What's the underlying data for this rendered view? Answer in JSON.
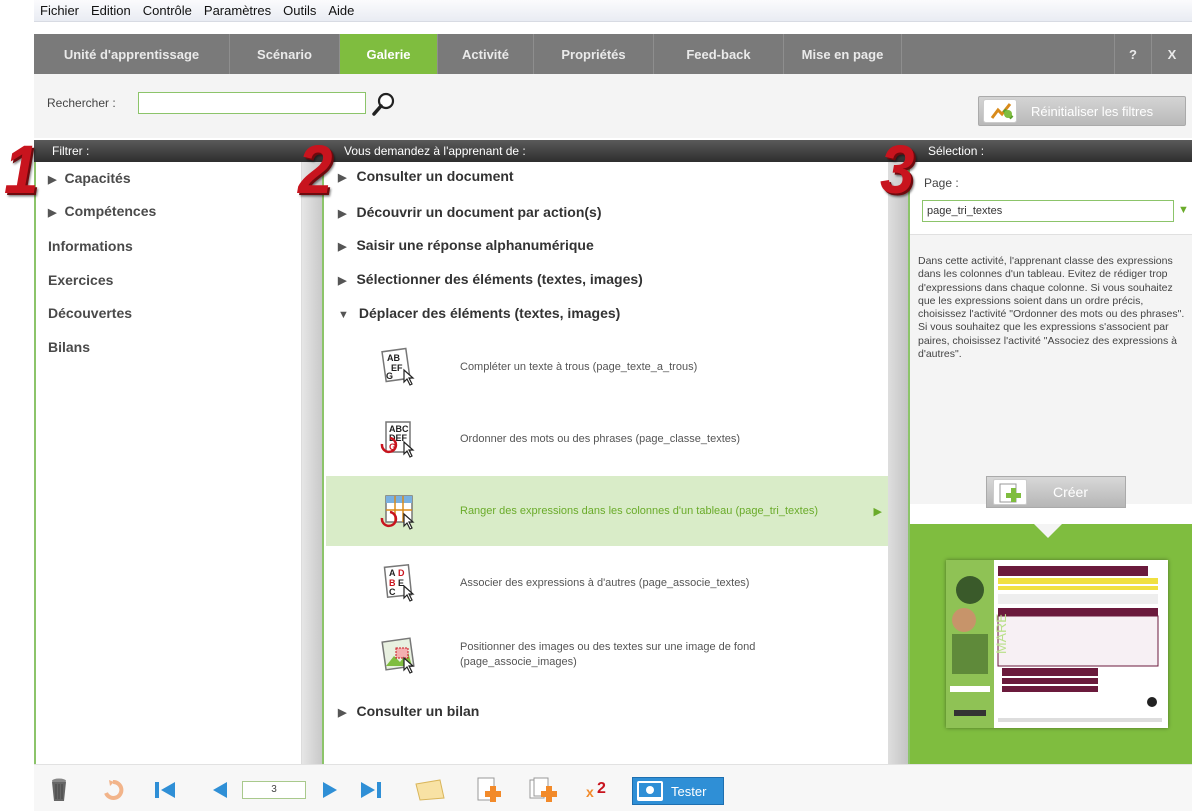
{
  "menu": [
    "Fichier",
    "Edition",
    "Contrôle",
    "Paramètres",
    "Outils",
    "Aide"
  ],
  "tabs": [
    {
      "label": "Unité d'apprentissage"
    },
    {
      "label": "Scénario"
    },
    {
      "label": "Galerie"
    },
    {
      "label": "Activité"
    },
    {
      "label": "Propriétés"
    },
    {
      "label": "Feed-back"
    },
    {
      "label": "Mise en page"
    }
  ],
  "window_buttons": {
    "help": "?",
    "close": "X"
  },
  "search": {
    "label": "Rechercher :",
    "value": "",
    "reset_label": "Réinitialiser les filtres"
  },
  "filter": {
    "header": "Filtrer :",
    "items": [
      "Capacités",
      "Compétences",
      "Informations",
      "Exercices",
      "Découvertes",
      "Bilans"
    ]
  },
  "activities": {
    "header": "Vous demandez à l'apprenant de :",
    "categories": [
      "Consulter un document",
      "Découvrir un document par action(s)",
      "Saisir une réponse alphanumérique",
      "Sélectionner des éléments (textes, images)",
      "Déplacer des éléments (textes, images)",
      "Consulter un bilan"
    ],
    "items": [
      "Compléter un texte à trous (page_texte_a_trous)",
      "Ordonner des mots ou des phrases (page_classe_textes)",
      "Ranger des expressions dans les colonnes d'un tableau (page_tri_textes)",
      "Associer des expressions à d'autres (page_associe_textes)",
      "Positionner des images ou des textes sur une image de fond (page_associe_images)"
    ]
  },
  "selection": {
    "header": "Sélection :",
    "page_label": "Page :",
    "page_value": "page_tri_textes",
    "description": "Dans cette activité, l'apprenant classe des expressions dans les colonnes d'un tableau. Evitez de rédiger trop d'expressions dans chaque colonne. Si vous souhaitez que les expressions soient dans un ordre précis, choisissez l'activité \"Ordonner des mots ou des phrases\". Si vous souhaitez que les expressions s'associent par paires, choisissez l'activité \"Associez des expressions à d'autres\".",
    "create_label": "Créer"
  },
  "annotations": [
    "1",
    "2",
    "3"
  ],
  "bottom": {
    "page_number": "3",
    "tester_label": "Tester"
  },
  "colors": {
    "accent_green": "#7fbd3f",
    "tab_gray": "#7a7a7a",
    "annotation_red": "#c8141e",
    "tester_blue": "#2f8fd6"
  }
}
